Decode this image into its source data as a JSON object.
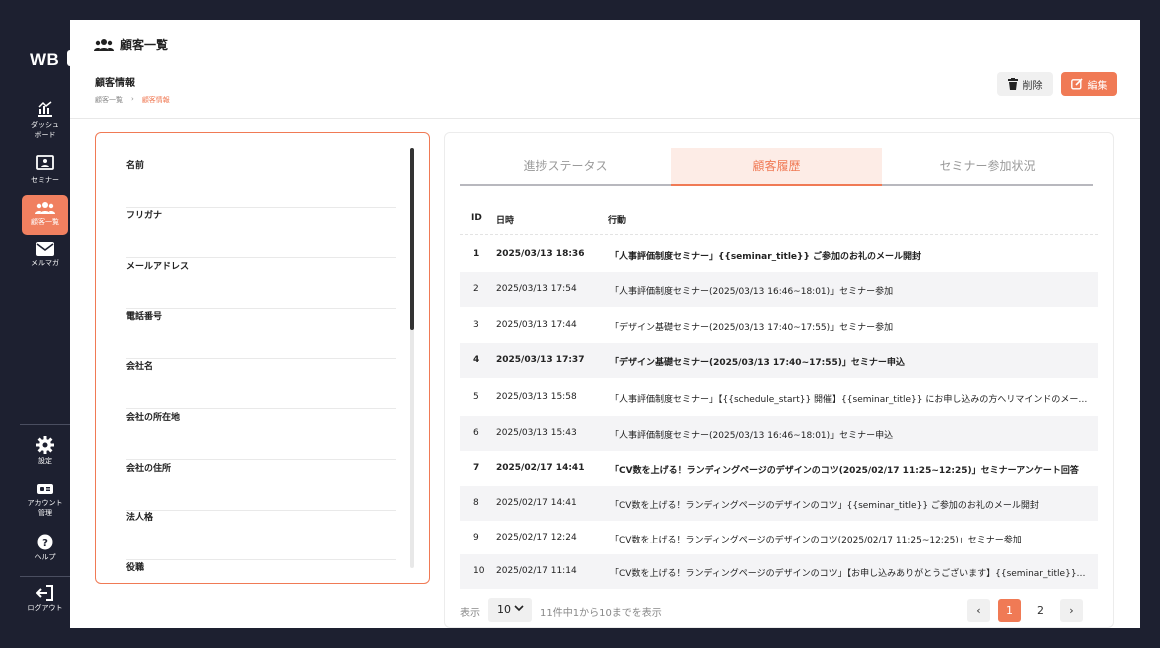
{
  "sidebar": {
    "logo": "WB",
    "toggle": "»",
    "items": [
      {
        "label": "ダッシュ\nボード"
      },
      {
        "label": "セミナー"
      },
      {
        "label": "顧客一覧"
      },
      {
        "label": "メルマガ"
      }
    ],
    "bottom_items": [
      {
        "label": "設定"
      },
      {
        "label": "アカウント\n管理"
      },
      {
        "label": "ヘルプ"
      }
    ],
    "logout": "ログアウト"
  },
  "header": {
    "title": "顧客一覧",
    "section_title": "顧客情報",
    "breadcrumb": [
      "顧客一覧",
      "›",
      "顧客情報"
    ],
    "delete_label": "削除",
    "edit_label": "編集"
  },
  "fields": [
    {
      "label": "名前"
    },
    {
      "label": "フリガナ"
    },
    {
      "label": "メールアドレス"
    },
    {
      "label": "電話番号"
    },
    {
      "label": "会社名"
    },
    {
      "label": "会社の所在地"
    },
    {
      "label": "会社の住所"
    },
    {
      "label": "法人格"
    },
    {
      "label": "役職"
    }
  ],
  "tabs": [
    {
      "label": "進捗ステータス"
    },
    {
      "label": "顧客履歴"
    },
    {
      "label": "セミナー参加状況"
    }
  ],
  "table": {
    "headers": {
      "id": "ID",
      "datetime": "日時",
      "action": "行動"
    },
    "rows": [
      {
        "id": "1",
        "datetime": "2025/03/13 18:36",
        "action": "「人事評価制度セミナー」{{seminar_title}} ご参加のお礼のメール開封"
      },
      {
        "id": "2",
        "datetime": "2025/03/13 17:54",
        "action": "「人事評価制度セミナー(2025/03/13 16:46~18:01)」セミナー参加"
      },
      {
        "id": "3",
        "datetime": "2025/03/13 17:44",
        "action": "「デザイン基礎セミナー(2025/03/13 17:40~17:55)」セミナー参加"
      },
      {
        "id": "4",
        "datetime": "2025/03/13 17:37",
        "action": "「デザイン基礎セミナー(2025/03/13 17:40~17:55)」セミナー申込"
      },
      {
        "id": "5",
        "datetime": "2025/03/13 15:58",
        "action": "「人事評価制度セミナー」【{{schedule_start}} 開催】{{seminar_title}} にお申し込みの方へリマインドのメール開封"
      },
      {
        "id": "6",
        "datetime": "2025/03/13 15:43",
        "action": "「人事評価制度セミナー(2025/03/13 16:46~18:01)」セミナー申込"
      },
      {
        "id": "7",
        "datetime": "2025/02/17 14:41",
        "action": "「CV数を上げる！ランディングページのデザインのコツ(2025/02/17 11:25~12:25)」セミナーアンケート回答"
      },
      {
        "id": "8",
        "datetime": "2025/02/17 14:41",
        "action": "「CV数を上げる！ランディングページのデザインのコツ」{{seminar_title}} ご参加のお礼のメール開封"
      },
      {
        "id": "9",
        "datetime": "2025/02/17 12:24",
        "action": "「CV数を上げる！ランディングページのデザインのコツ(2025/02/17 11:25~12:25)」セミナー参加"
      },
      {
        "id": "10",
        "datetime": "2025/02/17 11:14",
        "action": "「CV数を上げる！ランディングページのデザインのコツ」【お申し込みありがとうございます】{{seminar_title}}のメ…"
      }
    ]
  },
  "pagination": {
    "per_page_label": "表示",
    "per_page_value": "10",
    "info": "11件中1から10までを表示",
    "pages": [
      "1",
      "2"
    ],
    "current": "1",
    "prev": "‹",
    "next": "›"
  },
  "colors": {
    "accent": "#f07a55",
    "sidebar": "#1d2030"
  }
}
